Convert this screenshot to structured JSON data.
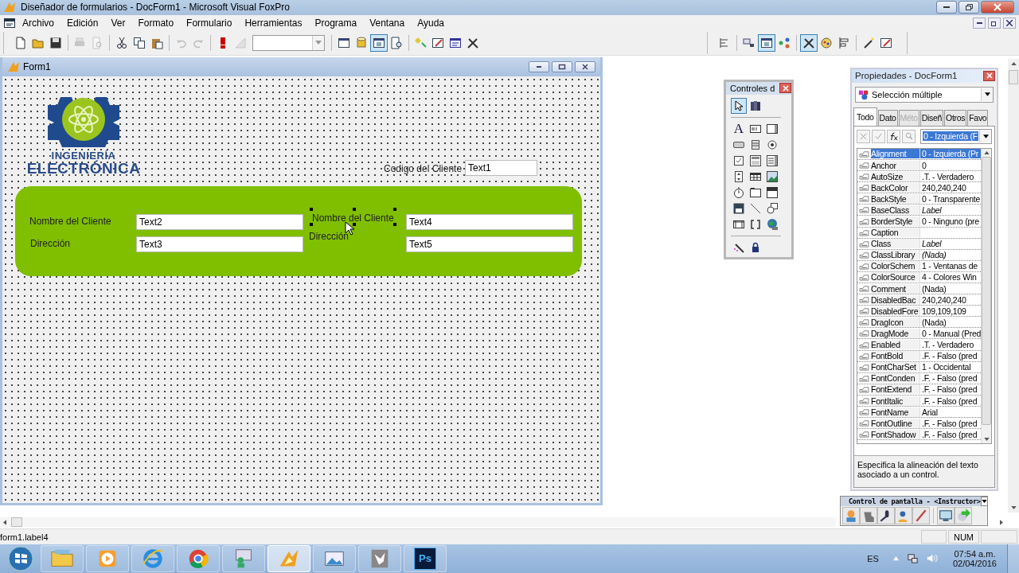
{
  "window": {
    "title": "Diseñador de formularios - DocForm1 - Microsoft Visual FoxPro"
  },
  "menu": [
    "Archivo",
    "Edición",
    "Ver",
    "Formato",
    "Formulario",
    "Herramientas",
    "Programa",
    "Ventana",
    "Ayuda"
  ],
  "toolbar": [
    {
      "kind": "new",
      "disabled": false,
      "pressed": false
    },
    {
      "kind": "open",
      "disabled": false,
      "pressed": false
    },
    {
      "kind": "save",
      "disabled": false,
      "pressed": false
    },
    {
      "kind": "sep"
    },
    {
      "kind": "print",
      "disabled": true,
      "pressed": false
    },
    {
      "kind": "preview",
      "disabled": true,
      "pressed": false
    },
    {
      "kind": "sep"
    },
    {
      "kind": "cut",
      "disabled": false,
      "pressed": false
    },
    {
      "kind": "copy",
      "disabled": false,
      "pressed": false
    },
    {
      "kind": "paste",
      "disabled": false,
      "pressed": false
    },
    {
      "kind": "sep"
    },
    {
      "kind": "undo",
      "disabled": true,
      "pressed": false
    },
    {
      "kind": "redo",
      "disabled": true,
      "pressed": false
    },
    {
      "kind": "sep"
    },
    {
      "kind": "run",
      "disabled": false,
      "pressed": false
    },
    {
      "kind": "modify",
      "disabled": true,
      "pressed": false
    },
    {
      "kind": "combo"
    },
    {
      "kind": "sep"
    },
    {
      "kind": "window",
      "disabled": false,
      "pressed": false
    },
    {
      "kind": "database",
      "disabled": false,
      "pressed": false
    },
    {
      "kind": "properties",
      "disabled": false,
      "pressed": true
    },
    {
      "kind": "code",
      "disabled": false,
      "pressed": false
    },
    {
      "kind": "sep"
    },
    {
      "kind": "builder",
      "disabled": false,
      "pressed": false
    },
    {
      "kind": "autoformat",
      "disabled": false,
      "pressed": false
    },
    {
      "kind": "calendar",
      "disabled": false,
      "pressed": false
    },
    {
      "kind": "tools",
      "disabled": false,
      "pressed": false
    }
  ],
  "right_toolbar": [
    {
      "kind": "layout",
      "disabled": false,
      "pressed": false
    },
    {
      "kind": "sep"
    },
    {
      "kind": "taborder",
      "disabled": false,
      "pressed": false
    },
    {
      "kind": "properties",
      "disabled": false,
      "pressed": true
    },
    {
      "kind": "classes",
      "disabled": false,
      "pressed": false
    },
    {
      "kind": "sep"
    },
    {
      "kind": "tools",
      "disabled": false,
      "pressed": true
    },
    {
      "kind": "palette",
      "disabled": false,
      "pressed": false
    },
    {
      "kind": "align",
      "disabled": false,
      "pressed": false
    },
    {
      "kind": "sep"
    },
    {
      "kind": "wand",
      "disabled": false,
      "pressed": false
    },
    {
      "kind": "autoformat",
      "disabled": false,
      "pressed": false
    }
  ],
  "form": {
    "title": "Form1",
    "logo": {
      "line1": "INGENIERÍA",
      "line2": "ELECTRÓNICA"
    },
    "codigo": {
      "label": "Codigo del Cliente",
      "value": "Text1"
    },
    "panel": [
      {
        "kind": "label",
        "text": "Nombre del Cliente",
        "selected": false
      },
      {
        "kind": "textbox",
        "value": "Text2",
        "selected": false
      },
      {
        "kind": "label",
        "text": "Nombre del Cliente",
        "selected": true
      },
      {
        "kind": "textbox",
        "value": "Text4",
        "selected": false
      },
      {
        "kind": "label",
        "text": "Dirección",
        "selected": false
      },
      {
        "kind": "textbox",
        "value": "Text3",
        "selected": false
      },
      {
        "kind": "label",
        "text": "Dirección",
        "selected": false
      },
      {
        "kind": "textbox",
        "value": "Text5",
        "selected": false
      }
    ]
  },
  "controls": {
    "title": "Controles d",
    "tools": [
      {
        "kind": "pointer",
        "selected": true
      },
      {
        "kind": "classes",
        "selected": false
      },
      {
        "kind": "sep"
      },
      {
        "kind": "label",
        "glyph": "A",
        "selected": false
      },
      {
        "kind": "textbox",
        "selected": false
      },
      {
        "kind": "editbox",
        "selected": false
      },
      {
        "kind": "button",
        "selected": false
      },
      {
        "kind": "buttongroup",
        "selected": false
      },
      {
        "kind": "option",
        "selected": false
      },
      {
        "kind": "check",
        "selected": false
      },
      {
        "kind": "combo",
        "selected": false
      },
      {
        "kind": "list",
        "selected": false
      },
      {
        "kind": "spinner",
        "selected": false
      },
      {
        "kind": "grid",
        "selected": false
      },
      {
        "kind": "image",
        "selected": false
      },
      {
        "kind": "timer",
        "selected": false
      },
      {
        "kind": "pageframe",
        "selected": false
      },
      {
        "kind": "ole",
        "selected": false
      },
      {
        "kind": "olebound",
        "selected": false
      },
      {
        "kind": "line",
        "selected": false
      },
      {
        "kind": "shape",
        "selected": false
      },
      {
        "kind": "container",
        "selected": false
      },
      {
        "kind": "separator",
        "selected": false
      },
      {
        "kind": "globe",
        "selected": false
      },
      {
        "kind": "sep"
      },
      {
        "kind": "wand",
        "selected": false
      },
      {
        "kind": "lock",
        "selected": false
      }
    ]
  },
  "properties": {
    "title": "Propiedades - DocForm1",
    "object": "Selección múltiple",
    "tabs": [
      {
        "label": "Todo",
        "selected": true,
        "disabled": false
      },
      {
        "label": "Dato",
        "selected": false,
        "disabled": false
      },
      {
        "label": "Méto",
        "selected": false,
        "disabled": true
      },
      {
        "label": "Diseñ",
        "selected": false,
        "disabled": false
      },
      {
        "label": "Otros",
        "selected": false,
        "disabled": false
      },
      {
        "label": "Favo",
        "selected": false,
        "disabled": false
      }
    ],
    "edit_value": "0 - Izquierda (F",
    "rows": [
      {
        "name": "Alignment",
        "value": "0 - Izquierda (Pr",
        "italic": false,
        "selected": true
      },
      {
        "name": "Anchor",
        "value": "0",
        "italic": false,
        "selected": false
      },
      {
        "name": "AutoSize",
        "value": ".T. - Verdadero",
        "italic": false,
        "selected": false
      },
      {
        "name": "BackColor",
        "value": "240,240,240",
        "italic": false,
        "selected": false
      },
      {
        "name": "BackStyle",
        "value": "0 - Transparente",
        "italic": false,
        "selected": false
      },
      {
        "name": "BaseClass",
        "value": "Label",
        "italic": true,
        "selected": false
      },
      {
        "name": "BorderStyle",
        "value": "0 - Ninguno (pre",
        "italic": false,
        "selected": false
      },
      {
        "name": "Caption",
        "selected": false
      },
      {
        "name": "Class",
        "value": "Label",
        "italic": true,
        "selected": false
      },
      {
        "name": "ClassLibrary",
        "value": "(Nada)",
        "italic": true,
        "selected": false
      },
      {
        "name": "ColorSchem",
        "value": "1 - Ventanas de",
        "italic": false,
        "selected": false
      },
      {
        "name": "ColorSource",
        "value": "4 - Colores Win",
        "italic": false,
        "selected": false
      },
      {
        "name": "Comment",
        "value": "(Nada)",
        "italic": false,
        "selected": false
      },
      {
        "name": "DisabledBac",
        "value": "240,240,240",
        "italic": false,
        "selected": false
      },
      {
        "name": "DisabledFore",
        "value": "109,109,109",
        "italic": false,
        "selected": false
      },
      {
        "name": "DragIcon",
        "value": "(Nada)",
        "italic": false,
        "selected": false
      },
      {
        "name": "DragMode",
        "value": "0 - Manual (Pred",
        "italic": false,
        "selected": false
      },
      {
        "name": "Enabled",
        "value": ".T. - Verdadero",
        "italic": false,
        "selected": false
      },
      {
        "name": "FontBold",
        "value": ".F. - Falso (pred",
        "italic": false,
        "selected": false
      },
      {
        "name": "FontCharSet",
        "value": "1 - Occidental",
        "italic": false,
        "selected": false
      },
      {
        "name": "FontConden",
        "value": ".F. - Falso (pred",
        "italic": false,
        "selected": false
      },
      {
        "name": "FontExtend",
        "value": ".F. - Falso (pred",
        "italic": false,
        "selected": false
      },
      {
        "name": "FontItalic",
        "value": ".F. - Falso (pred",
        "italic": false,
        "selected": false
      },
      {
        "name": "FontName",
        "value": "Arial",
        "italic": false,
        "selected": false
      },
      {
        "name": "FontOutline",
        "value": ".F. - Falso (pred",
        "italic": false,
        "selected": false
      },
      {
        "name": "FontShadow",
        "value": ".F. - Falso (pred",
        "italic": false,
        "selected": false
      }
    ],
    "description": "Especifica la alineación del texto asociado a un control."
  },
  "screen_control": {
    "title": "Control de pantalla - <Instructor>",
    "tools": [
      {
        "kind": "agent"
      },
      {
        "kind": "hand"
      },
      {
        "kind": "microphone"
      },
      {
        "kind": "user"
      },
      {
        "kind": "pencil"
      },
      {
        "kind": "sep"
      },
      {
        "kind": "monitor"
      },
      {
        "kind": "next"
      }
    ]
  },
  "status_bar": {
    "text": "form1.label4",
    "num": "NUM"
  },
  "taskbar": {
    "apps": [
      {
        "kind": "explorer",
        "selected": false
      },
      {
        "kind": "media",
        "selected": false
      },
      {
        "kind": "ie",
        "selected": false
      },
      {
        "kind": "chrome",
        "selected": false
      },
      {
        "kind": "users",
        "selected": false
      },
      {
        "kind": "foxpro",
        "selected": true
      },
      {
        "kind": "photo",
        "selected": false
      },
      {
        "kind": "bird",
        "selected": false
      },
      {
        "kind": "photoshop",
        "glyph": "Ps",
        "selected": false
      }
    ],
    "language": "ES",
    "time": "07:54 a.m.",
    "date": "02/04/2016"
  }
}
